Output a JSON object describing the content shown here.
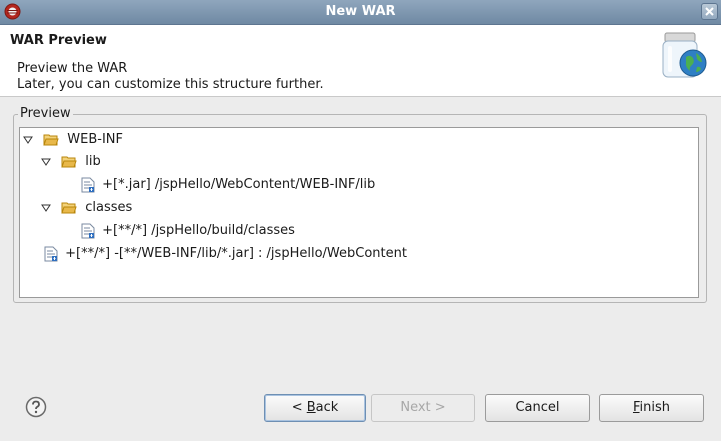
{
  "window": {
    "title": "New WAR"
  },
  "banner": {
    "heading": "WAR Preview",
    "description_line1": "Preview the WAR",
    "description_line2": "Later, you can customize this structure further.",
    "icon": "jar-globe-icon"
  },
  "group": {
    "label": "Preview",
    "tree": [
      {
        "label": "WEB-INF",
        "icon": "folder-open-icon",
        "expanded": true,
        "depth": 0
      },
      {
        "label": "lib",
        "icon": "folder-open-icon",
        "expanded": true,
        "depth": 1
      },
      {
        "label": "+[*.jar] /jspHello/WebContent/WEB-INF/lib",
        "icon": "resource-file-icon",
        "depth": 2
      },
      {
        "label": "classes",
        "icon": "folder-open-icon",
        "expanded": true,
        "depth": 1
      },
      {
        "label": "+[**/*] /jspHello/build/classes",
        "icon": "resource-file-icon",
        "depth": 2
      },
      {
        "label": "+[**/*] -[**/WEB-INF/lib/*.jar] : /jspHello/WebContent",
        "icon": "resource-file-icon",
        "depth": 0
      }
    ]
  },
  "buttons": {
    "back": {
      "prefix": "< ",
      "mnemonic": "B",
      "rest": "ack"
    },
    "next": {
      "label": "Next >",
      "enabled": false
    },
    "cancel": "Cancel",
    "finish": {
      "mnemonic": "F",
      "rest": "inish"
    }
  },
  "help_icon": "help-icon",
  "colors": {
    "titlebar": "#7b94ad",
    "folder": "#e8b84a",
    "link_blue": "#2f6fbf"
  }
}
